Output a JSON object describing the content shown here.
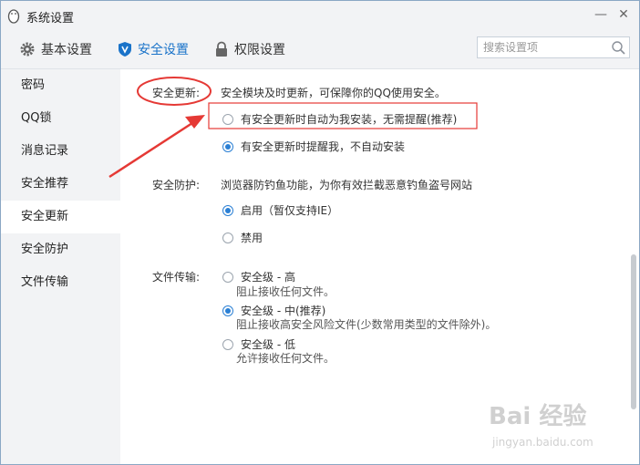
{
  "window": {
    "title": "系统设置",
    "min_glyph": "—",
    "close_glyph": "✕"
  },
  "toolbar": {
    "tabs": [
      {
        "label": "基本设置",
        "icon": "gear-icon",
        "active": false
      },
      {
        "label": "安全设置",
        "icon": "shield-icon",
        "active": true
      },
      {
        "label": "权限设置",
        "icon": "lock-icon",
        "active": false
      }
    ],
    "search_placeholder": "搜索设置项"
  },
  "sidebar": {
    "items": [
      {
        "label": "密码",
        "active": false
      },
      {
        "label": "QQ锁",
        "active": false
      },
      {
        "label": "消息记录",
        "active": false
      },
      {
        "label": "安全推荐",
        "active": false
      },
      {
        "label": "安全更新",
        "active": true
      },
      {
        "label": "安全防护",
        "active": false
      },
      {
        "label": "文件传输",
        "active": false
      }
    ]
  },
  "main": {
    "update": {
      "label": "安全更新:",
      "desc": "安全模块及时更新，可保障你的QQ使用安全。",
      "options": [
        {
          "label": "有安全更新时自动为我安装，无需提醒(推荐)",
          "checked": false
        },
        {
          "label": "有安全更新时提醒我，不自动安装",
          "checked": true
        }
      ]
    },
    "protect": {
      "label": "安全防护:",
      "desc": "浏览器防钓鱼功能，为你有效拦截恶意钓鱼盗号网站",
      "options": [
        {
          "label": "启用（暂仅支持IE）",
          "checked": true
        },
        {
          "label": "禁用",
          "checked": false
        }
      ]
    },
    "transfer": {
      "label": "文件传输:",
      "options": [
        {
          "label": "安全级 - 高",
          "sub": "阻止接收任何文件。",
          "checked": false
        },
        {
          "label": "安全级 - 中(推荐)",
          "sub": "阻止接收高安全风险文件(少数常用类型的文件除外)。",
          "checked": true
        },
        {
          "label": "安全级 - 低",
          "sub": "允许接收任何文件。",
          "checked": false
        }
      ]
    }
  },
  "watermark": {
    "text": "Bai 经验",
    "sub": "jingyan.baidu.com"
  },
  "colors": {
    "accent": "#1a73c9",
    "annotation_red": "#e53935",
    "sidebar_bg": "#f2f3f5"
  }
}
